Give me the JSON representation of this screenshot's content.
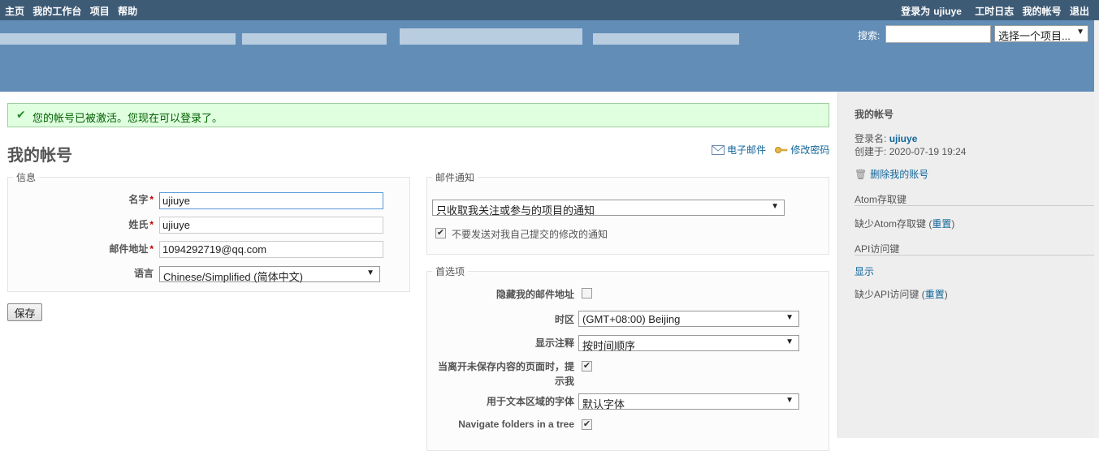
{
  "top_menu": {
    "items": [
      "主页",
      "我的工作台",
      "项目",
      "帮助"
    ],
    "login_label": "登录为",
    "login_user": "ujiuye",
    "right_items": [
      "工时日志",
      "我的帐号",
      "退出"
    ]
  },
  "header": {
    "search_label": "搜索:",
    "search_value": "",
    "project_select": "选择一个项目..."
  },
  "flash": {
    "message": "您的帐号已被激活。您现在可以登录了。"
  },
  "page": {
    "title": "我的帐号",
    "links": {
      "email": "电子邮件",
      "change_password": "修改密码"
    }
  },
  "info": {
    "legend": "信息",
    "name_label": "名字",
    "name_value": "ujiuye",
    "surname_label": "姓氏",
    "surname_value": "ujiuye",
    "email_label": "邮件地址",
    "email_value": "1094292719@qq.com",
    "lang_label": "语言",
    "lang_value": "Chinese/Simplified (简体中文)",
    "required_mark": "*"
  },
  "save_label": "保存",
  "mail_notification": {
    "legend": "邮件通知",
    "select_value": "只收取我关注或参与的项目的通知",
    "no_self_label": "不要发送对我自己提交的修改的通知",
    "no_self_checked": true
  },
  "preferences": {
    "legend": "首选项",
    "hide_mail_label": "隐藏我的邮件地址",
    "hide_mail_checked": false,
    "timezone_label": "时区",
    "timezone_value": "(GMT+08:00) Beijing",
    "comments_label": "显示注释",
    "comments_value": "按时间顺序",
    "warn_label_line1": "当离开未保存内容的页面时，提",
    "warn_label_line2": "示我",
    "warn_checked": true,
    "font_label": "用于文本区域的字体",
    "font_value": "默认字体",
    "folders_label": "Navigate folders in a tree",
    "folders_checked": true
  },
  "sidebar": {
    "title": "我的帐号",
    "login_label": "登录名:",
    "login_value": "ujiuye",
    "created_label": "创建于:",
    "created_value": "2020-07-19 19:24",
    "delete_label": "删除我的账号",
    "atom_title": "Atom存取键",
    "atom_missing": "缺少Atom存取键",
    "atom_reset": "重置",
    "api_title": "API访问键",
    "api_show": "显示",
    "api_missing": "缺少API访问键",
    "api_reset": "重置"
  },
  "icons": {
    "check": "check-icon",
    "mail": "mail-icon",
    "key": "key-icon",
    "trash": "trash-icon"
  }
}
